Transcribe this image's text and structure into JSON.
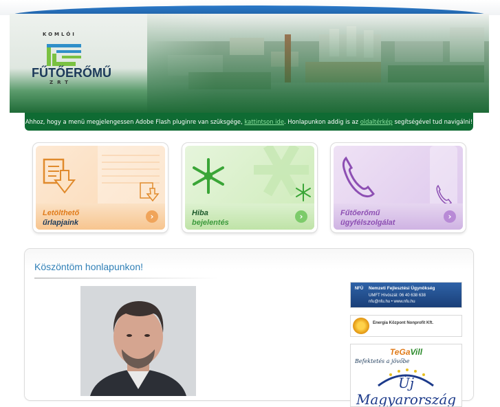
{
  "logo": {
    "top": "KOMLÓI",
    "name": "FŰTŐERŐMŰ",
    "bottom": "ZRT"
  },
  "flash": {
    "before": "Ahhoz, hogy a menü megjelengessen Adobe Flash pluginre van szüksgége, ",
    "link1": "kattintson ide",
    "middle": ". Honlapunkon addig is az ",
    "link2": "oldaltérkép",
    "after": " segítségével tud navigálni!"
  },
  "cards": [
    {
      "line1": "Letölthető",
      "line2": "űrlapjaink",
      "icon": "document-download-icon"
    },
    {
      "line1": "Hiba",
      "line2": "bejelentés",
      "icon": "snowflake-icon"
    },
    {
      "line1": "Fűtőerőmű",
      "line2": "ügyfélszolgálat",
      "icon": "phone-icon"
    }
  ],
  "content": {
    "heading": "Köszöntöm honlapunkon!"
  },
  "banners": {
    "nfu": {
      "logo": "NFÜ",
      "title": "Nemzeti Fejlesztési Ügynökség",
      "phone": "UMFT Hívószál: 06 40 638 638",
      "web": "nfu@nfu.hu  •  www.nfu.hu"
    },
    "energia": {
      "title": "Energia Központ Nonprofit Kft.",
      "subtitle": ""
    },
    "tegavill": {
      "brand_a": "TeGa",
      "brand_b": "Vill",
      "slogan": "Befektetés a jövőbe",
      "headline": "Új Magyarország"
    }
  },
  "colors": {
    "green_dark": "#0f6b33",
    "link_green": "#8ce49e",
    "heading_blue": "#2f7fb6"
  }
}
